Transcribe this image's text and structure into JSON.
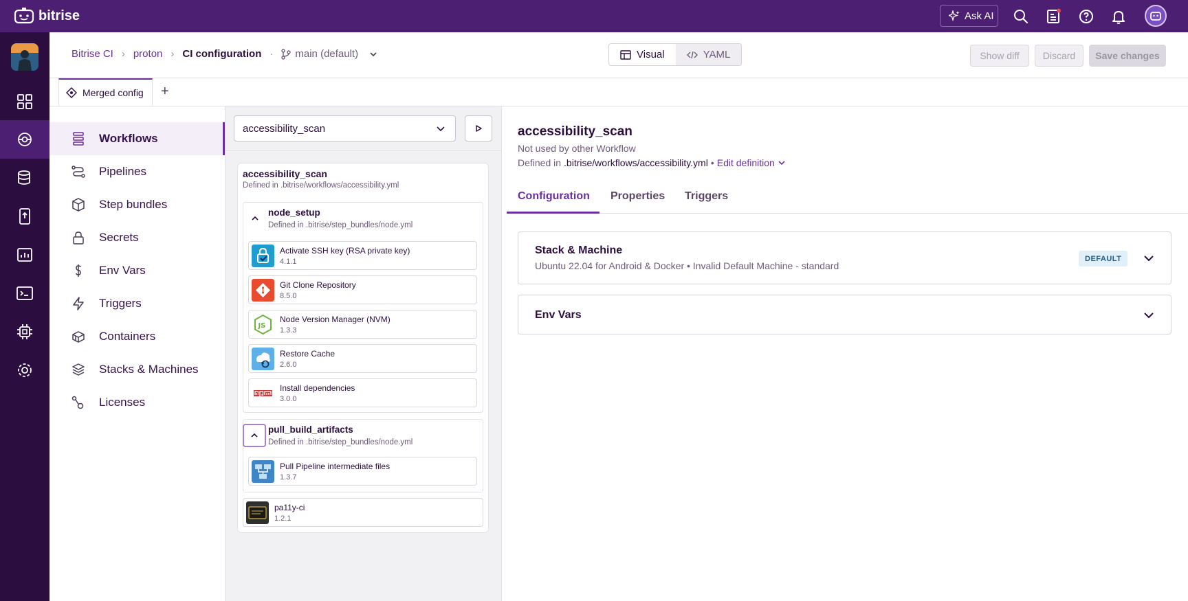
{
  "app": {
    "brand": "bitrise"
  },
  "topbar": {
    "ask_ai": "Ask AI"
  },
  "breadcrumb": {
    "items": [
      "Bitrise CI",
      "proton"
    ],
    "current": "CI configuration",
    "branch": "main (default)"
  },
  "view_toggle": {
    "visual": "Visual",
    "yaml": "YAML"
  },
  "actions": {
    "show_diff": "Show diff",
    "discard": "Discard",
    "save": "Save changes"
  },
  "config_tabs": {
    "merged": "Merged config",
    "add": "+"
  },
  "sidenav": {
    "items": [
      {
        "label": "Workflows",
        "icon": "workflows-icon"
      },
      {
        "label": "Pipelines",
        "icon": "pipelines-icon"
      },
      {
        "label": "Step bundles",
        "icon": "step-bundles-icon"
      },
      {
        "label": "Secrets",
        "icon": "lock-icon"
      },
      {
        "label": "Env Vars",
        "icon": "dollar-icon"
      },
      {
        "label": "Triggers",
        "icon": "lightning-icon"
      },
      {
        "label": "Containers",
        "icon": "containers-icon"
      },
      {
        "label": "Stacks & Machines",
        "icon": "stacks-icon"
      },
      {
        "label": "Licenses",
        "icon": "licenses-icon"
      }
    ]
  },
  "workflow_editor": {
    "selected": "accessibility_scan",
    "card_title": "accessibility_scan",
    "card_defined": "Defined in .bitrise/workflows/accessibility.yml",
    "bundles": [
      {
        "name": "node_setup",
        "defined": "Defined in .bitrise/step_bundles/node.yml",
        "steps": [
          {
            "name": "Activate SSH key (RSA private key)",
            "version": "4.1.1"
          },
          {
            "name": "Git Clone Repository",
            "version": "8.5.0"
          },
          {
            "name": "Node Version Manager (NVM)",
            "version": "1.3.3"
          },
          {
            "name": "Restore Cache",
            "version": "2.6.0"
          },
          {
            "name": "Install dependencies",
            "version": "3.0.0"
          }
        ]
      },
      {
        "name": "pull_build_artifacts",
        "defined": "Defined in .bitrise/step_bundles/node.yml",
        "steps": [
          {
            "name": "Pull Pipeline intermediate files",
            "version": "1.3.7"
          }
        ]
      }
    ],
    "loose_step": {
      "name": "pa11y-ci",
      "version": "1.2.1"
    }
  },
  "details": {
    "title": "accessibility_scan",
    "usage": "Not used by other Workflow",
    "defined_prefix": "Defined in",
    "defined_path": ".bitrise/workflows/accessibility.yml",
    "separator": "•",
    "edit_link": "Edit definition",
    "tabs": [
      "Configuration",
      "Properties",
      "Triggers"
    ],
    "stack_panel": {
      "title": "Stack & Machine",
      "subtitle": "Ubuntu 22.04 for Android & Docker • Invalid Default Machine - standard",
      "badge": "DEFAULT"
    },
    "env_panel": {
      "title": "Env Vars"
    }
  },
  "colors": {
    "brand": "#4d1f72",
    "accent": "#6b2fa0",
    "rail": "#2b0e3f"
  }
}
